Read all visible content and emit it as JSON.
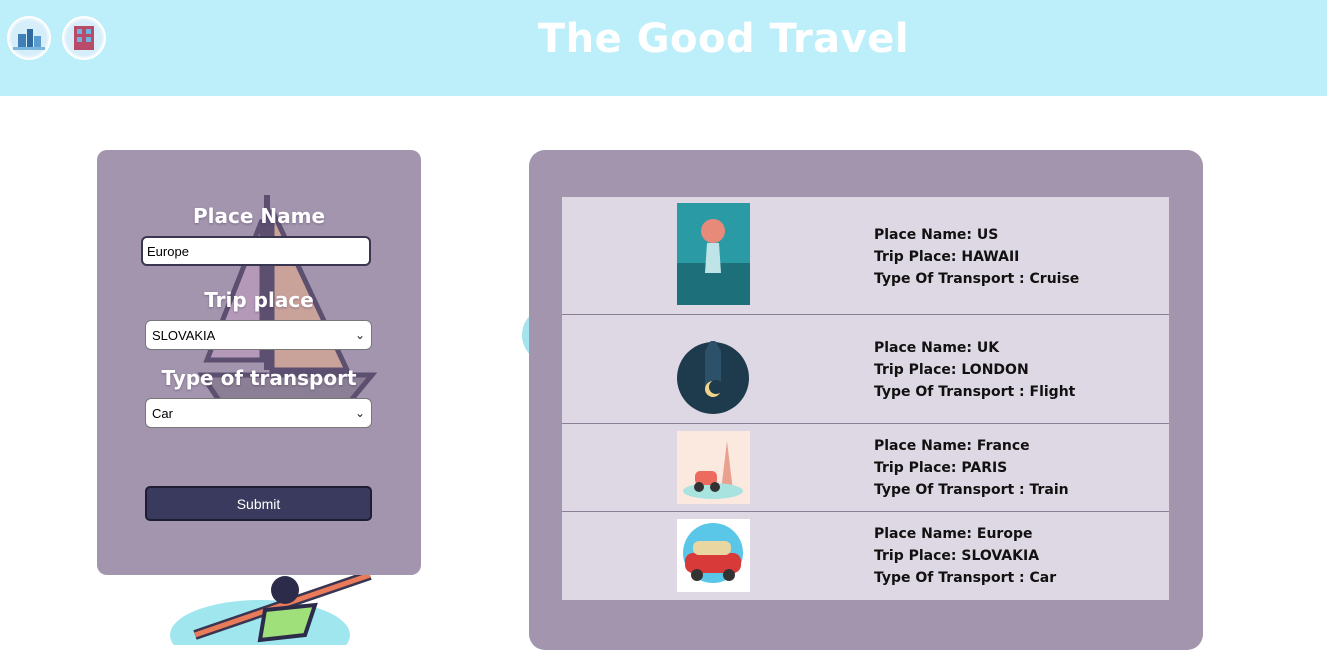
{
  "header": {
    "title": "The Good Travel"
  },
  "form": {
    "place_label": "Place Name",
    "place_value": "Europe",
    "trip_label": "Trip place",
    "trip_selected": "SLOVAKIA",
    "transport_label": "Type of transport",
    "transport_selected": "Car",
    "submit_label": "Submit"
  },
  "trips": [
    {
      "place": "Place Name: US",
      "trip": "Trip Place: HAWAII",
      "transport": "Type Of Transport : Cruise"
    },
    {
      "place": "Place Name: UK",
      "trip": "Trip Place: LONDON",
      "transport": "Type Of Transport : Flight"
    },
    {
      "place": "Place Name: France",
      "trip": "Trip Place: PARIS",
      "transport": "Type Of Transport : Train"
    },
    {
      "place": "Place Name: Europe",
      "trip": "Trip Place: SLOVAKIA",
      "transport": "Type Of Transport : Car"
    }
  ]
}
